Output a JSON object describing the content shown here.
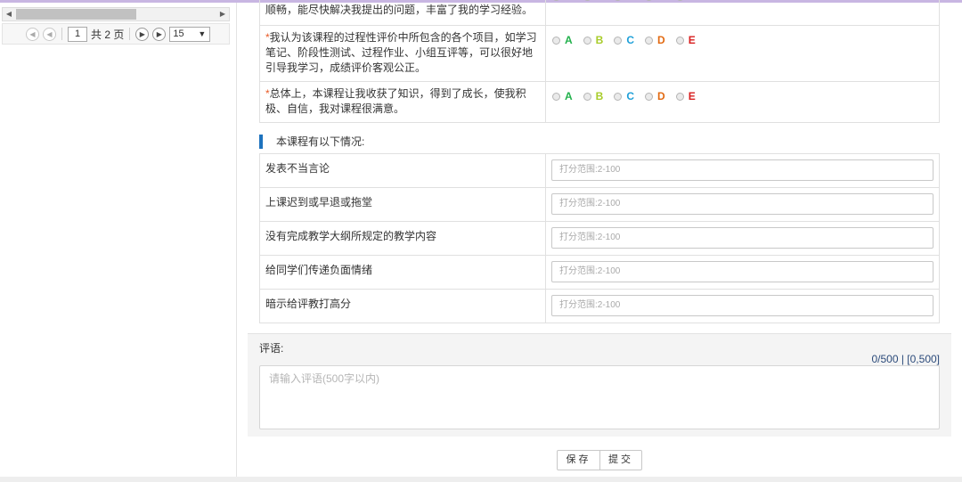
{
  "pager": {
    "current_page": "1",
    "total_pages": "共 2 页",
    "page_size": "15"
  },
  "ratings": [
    {
      "text": "顺畅，能尽快解决我提出的问题，丰富了我的学习经验。",
      "required": false,
      "options": [
        "A",
        "B",
        "C",
        "D",
        "E"
      ]
    },
    {
      "text": "我认为该课程的过程性评价中所包含的各个项目，如学习笔记、阶段性测试、过程作业、小组互评等，可以很好地引导我学习，成绩评价客观公正。",
      "required": true,
      "options": [
        "A",
        "B",
        "C",
        "D",
        "E"
      ]
    },
    {
      "text": "总体上，本课程让我收获了知识，得到了成长，使我积极、自信，我对课程很满意。",
      "required": true,
      "options": [
        "A",
        "B",
        "C",
        "D",
        "E"
      ]
    }
  ],
  "option_colors": {
    "A": "#22b14c",
    "B": "#a8cc2a",
    "C": "#1fa0d8",
    "D": "#e26a12",
    "E": "#d81e1e"
  },
  "section": {
    "title": "本课程有以下情况:",
    "rows": [
      {
        "label": "发表不当言论",
        "placeholder": "打分范围:2-100"
      },
      {
        "label": "上课迟到或早退或拖堂",
        "placeholder": "打分范围:2-100"
      },
      {
        "label": "没有完成教学大纲所规定的教学内容",
        "placeholder": "打分范围:2-100"
      },
      {
        "label": "给同学们传递负面情绪",
        "placeholder": "打分范围:2-100"
      },
      {
        "label": "暗示给评教打高分",
        "placeholder": "打分范围:2-100"
      }
    ]
  },
  "comment": {
    "label": "评语:",
    "count": "0/500 | [0,500]",
    "placeholder": "请输入评语(500字以内)"
  },
  "buttons": {
    "save": "保存",
    "submit": "提交"
  }
}
